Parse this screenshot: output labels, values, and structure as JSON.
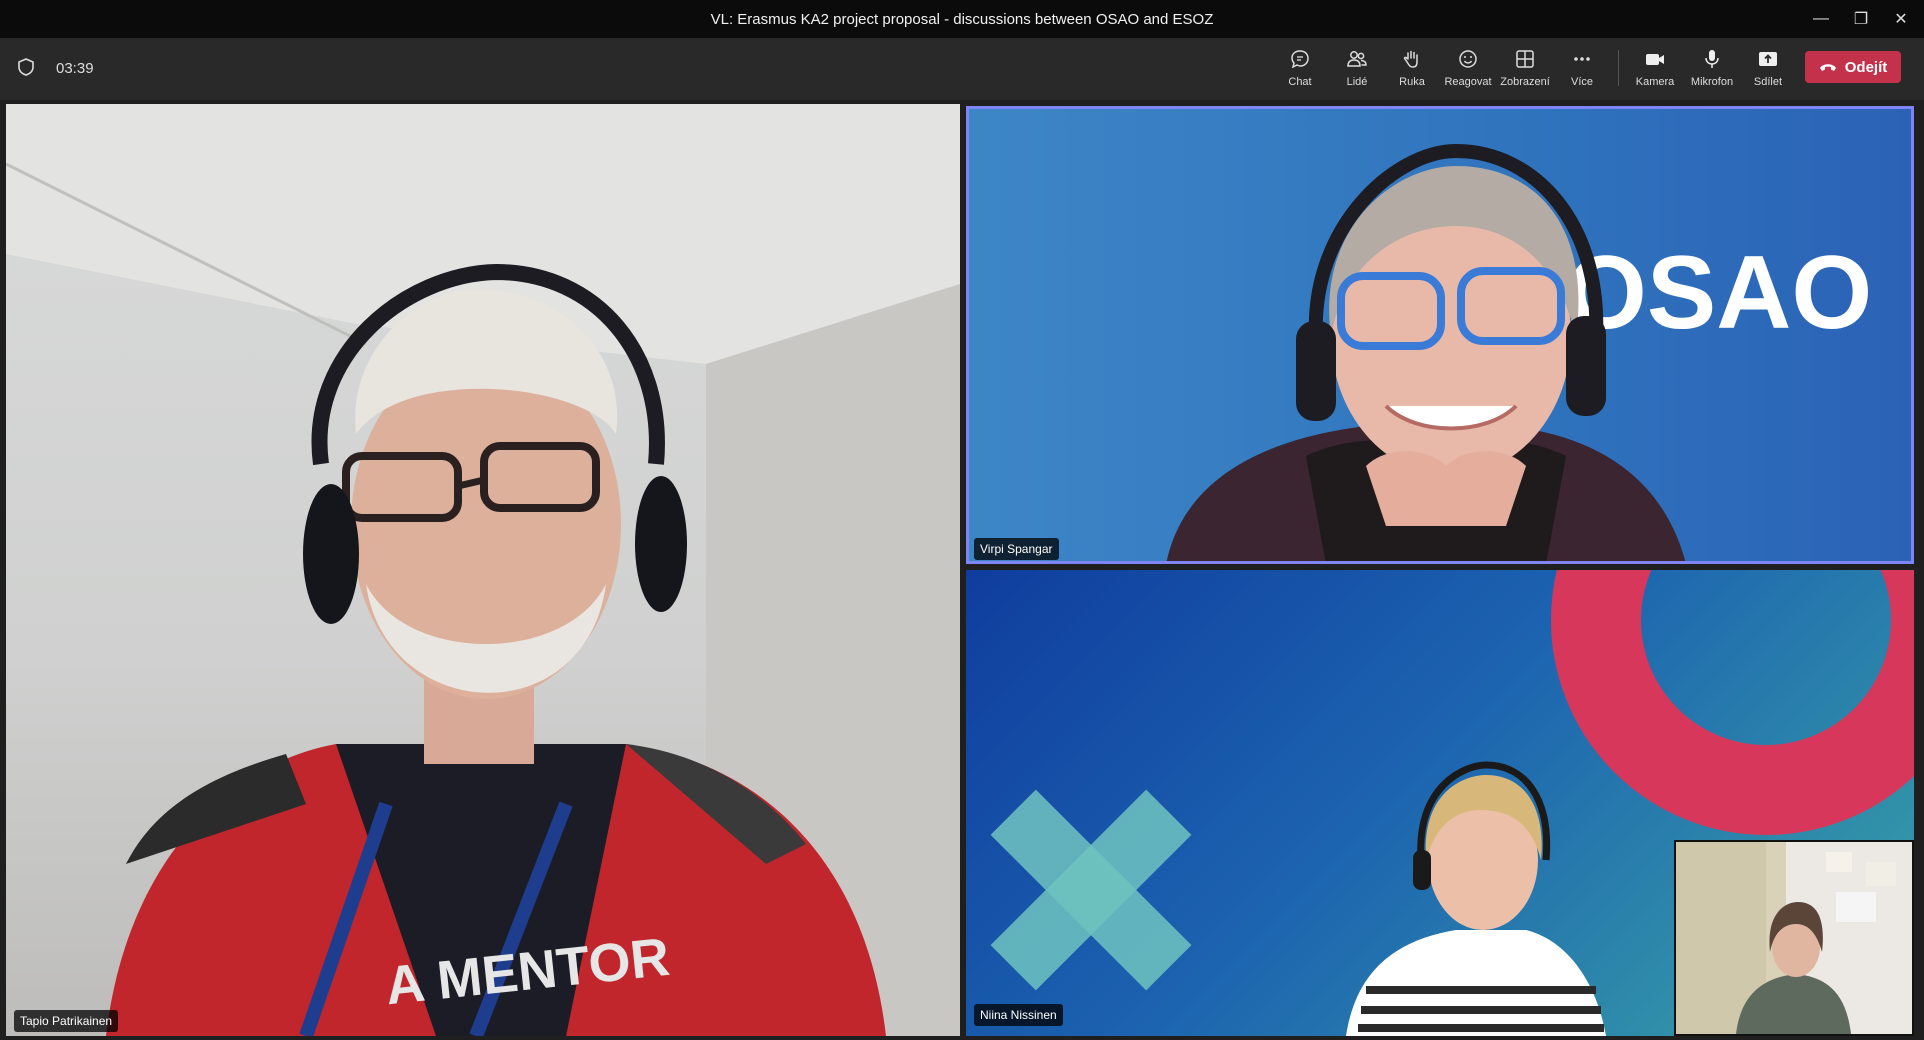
{
  "window": {
    "title": "VL: Erasmus KA2 project proposal - discussions between OSAO and ESOZ"
  },
  "call": {
    "elapsed": "03:39"
  },
  "toolbar": {
    "chat": "Chat",
    "people": "Lidé",
    "raise_hand": "Ruka",
    "react": "Reagovat",
    "view": "Zobrazení",
    "more": "Více",
    "camera": "Kamera",
    "mic": "Mikrofon",
    "share": "Sdílet",
    "leave": "Odejít"
  },
  "participants": [
    {
      "name": "Tapio Patrikainen"
    },
    {
      "name": "Virpi Spangar",
      "backdrop_text": "OSAO"
    },
    {
      "name": "Niina Nissinen"
    }
  ],
  "shirt_text": "A MENTOR",
  "colors": {
    "leave": "#c4314b",
    "active_speaker": "#7f85f5"
  }
}
